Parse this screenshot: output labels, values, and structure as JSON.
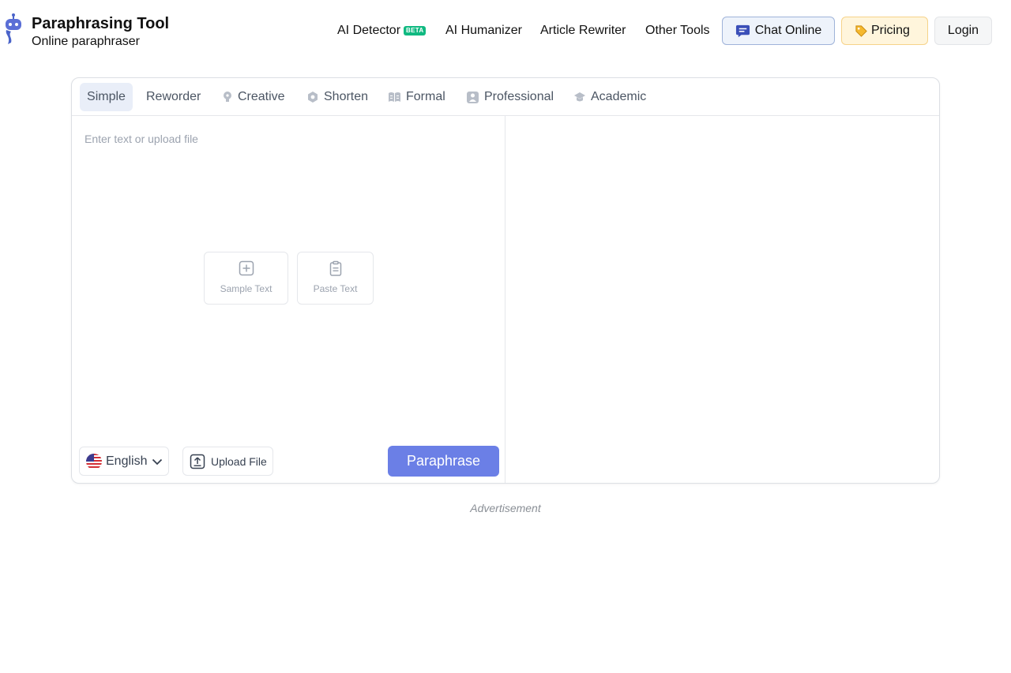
{
  "brand": {
    "title": "Paraphrasing Tool",
    "subtitle": "Online paraphraser",
    "logo_icon": "robot-logo-icon"
  },
  "nav": {
    "ai_detector": "AI Detector",
    "beta_badge": "BETA",
    "ai_humanizer": "AI Humanizer",
    "article_rewriter": "Article Rewriter",
    "other_tools": "Other Tools",
    "chat_online": "Chat Online",
    "pricing": "Pricing",
    "login": "Login"
  },
  "modes": {
    "active": "Simple",
    "tabs": [
      {
        "label": "Simple",
        "icon": ""
      },
      {
        "label": "Reworder",
        "icon": ""
      },
      {
        "label": "Creative",
        "icon": "lightbulb-icon"
      },
      {
        "label": "Shorten",
        "icon": "hexagon-icon"
      },
      {
        "label": "Formal",
        "icon": "open-book-icon"
      },
      {
        "label": "Professional",
        "icon": "badge-icon"
      },
      {
        "label": "Academic",
        "icon": "graduation-cap-icon"
      }
    ]
  },
  "editor": {
    "placeholder": "Enter text or upload file",
    "sample_text": "Sample Text",
    "paste_text": "Paste Text",
    "language": "English",
    "upload_file": "Upload File",
    "paraphrase": "Paraphrase"
  },
  "advertisement": "Advertisement",
  "colors": {
    "primary_button": "#6b7fe6",
    "beta_badge": "#10b981",
    "chat_button_bg": "#eef3fb",
    "pricing_button_bg": "#fff5dc",
    "active_tab_bg": "#e9eef8"
  }
}
